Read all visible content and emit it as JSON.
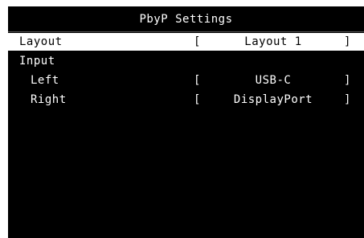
{
  "title": "PbyP Settings",
  "bracket_open": "[",
  "bracket_close": "]",
  "menu": {
    "layout": {
      "label": "Layout",
      "value": "Layout 1"
    },
    "input": {
      "label": "Input"
    },
    "left": {
      "label": "Left",
      "value": "USB-C"
    },
    "right": {
      "label": "Right",
      "value": "DisplayPort"
    }
  }
}
